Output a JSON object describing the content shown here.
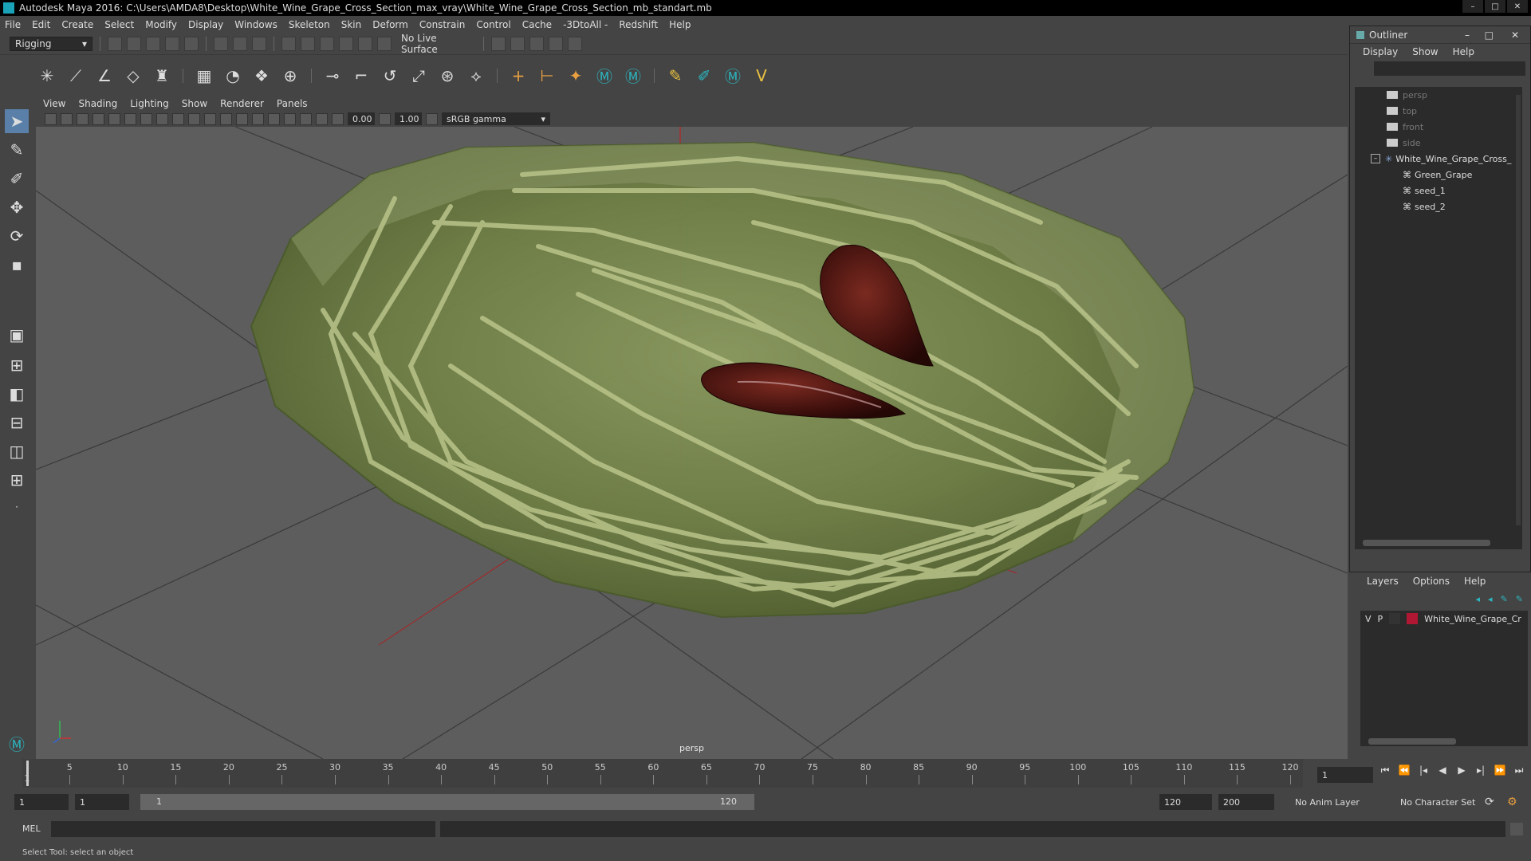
{
  "window": {
    "title": "Autodesk Maya 2016: C:\\Users\\AMDA8\\Desktop\\White_Wine_Grape_Cross_Section_max_vray\\White_Wine_Grape_Cross_Section_mb_standart.mb",
    "minimize": "–",
    "maximize": "□",
    "close": "✕"
  },
  "menubar": [
    "File",
    "Edit",
    "Create",
    "Select",
    "Modify",
    "Display",
    "Windows",
    "Skeleton",
    "Skin",
    "Deform",
    "Constrain",
    "Control",
    "Cache",
    "-3DtoAll -",
    "Redshift",
    "Help"
  ],
  "statusline": {
    "mode": "Rigging",
    "live_surface": "No Live Surface"
  },
  "panel": {
    "menus": [
      "View",
      "Shading",
      "Lighting",
      "Show",
      "Renderer",
      "Panels"
    ],
    "exposure": "0.00",
    "gamma": "1.00",
    "color_space": "sRGB gamma",
    "camera": "persp"
  },
  "outliner": {
    "title": "Outliner",
    "menus": [
      "Display",
      "Show",
      "Help"
    ],
    "items": [
      {
        "label": "persp",
        "dim": true
      },
      {
        "label": "top",
        "dim": true
      },
      {
        "label": "front",
        "dim": true
      },
      {
        "label": "side",
        "dim": true
      },
      {
        "label": "White_Wine_Grape_Cross_",
        "dim": false
      },
      {
        "label": "Green_Grape",
        "dim": false
      },
      {
        "label": "seed_1",
        "dim": false
      },
      {
        "label": "seed_2",
        "dim": false
      }
    ]
  },
  "layers": {
    "menus": [
      "Layers",
      "Options",
      "Help"
    ],
    "row": {
      "v": "V",
      "p": "P",
      "name": "White_Wine_Grape_Cr",
      "color": "#b01733"
    }
  },
  "timeline": {
    "ticks": [
      "5",
      "10",
      "15",
      "20",
      "25",
      "30",
      "35",
      "40",
      "45",
      "50",
      "55",
      "60",
      "65",
      "70",
      "75",
      "80",
      "85",
      "90",
      "95",
      "100",
      "105",
      "110",
      "115",
      "120"
    ],
    "current_frame": "1",
    "start_marker": "1"
  },
  "range": {
    "start": "1",
    "playback_start": "1",
    "range_start_label": "1",
    "range_end_label": "120",
    "playback_end": "120",
    "end": "200",
    "anim_layer": "No Anim Layer",
    "character_set": "No Character Set"
  },
  "cmdline": {
    "label": "MEL"
  },
  "help_line": "Select Tool: select an object"
}
